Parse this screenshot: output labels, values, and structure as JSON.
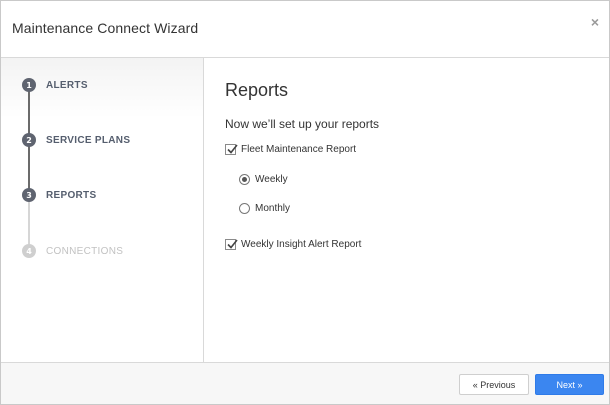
{
  "window": {
    "title": "Maintenance Connect Wizard",
    "close_glyph": "×"
  },
  "steps": [
    {
      "number": "1",
      "label": "ALERTS",
      "state": "done"
    },
    {
      "number": "2",
      "label": "SERVICE PLANS",
      "state": "done"
    },
    {
      "number": "3",
      "label": "REPORTS",
      "state": "current"
    },
    {
      "number": "4",
      "label": "CONNECTIONS",
      "state": "upcoming"
    }
  ],
  "main": {
    "heading": "Reports",
    "subtitle": "Now we’ll set up your reports",
    "fleet_report": {
      "label": "Fleet Maintenance Report",
      "checked": true
    },
    "frequency": {
      "options": [
        {
          "label": "Weekly",
          "selected": true
        },
        {
          "label": "Monthly",
          "selected": false
        }
      ]
    },
    "insight_report": {
      "label": "Weekly Insight Alert Report",
      "checked": true
    }
  },
  "footer": {
    "previous_label": "« Previous",
    "next_label": "Next »"
  },
  "colors": {
    "accent": "#3b86f0",
    "step_active": "#5f6470",
    "step_inactive": "#cfcfcf"
  }
}
